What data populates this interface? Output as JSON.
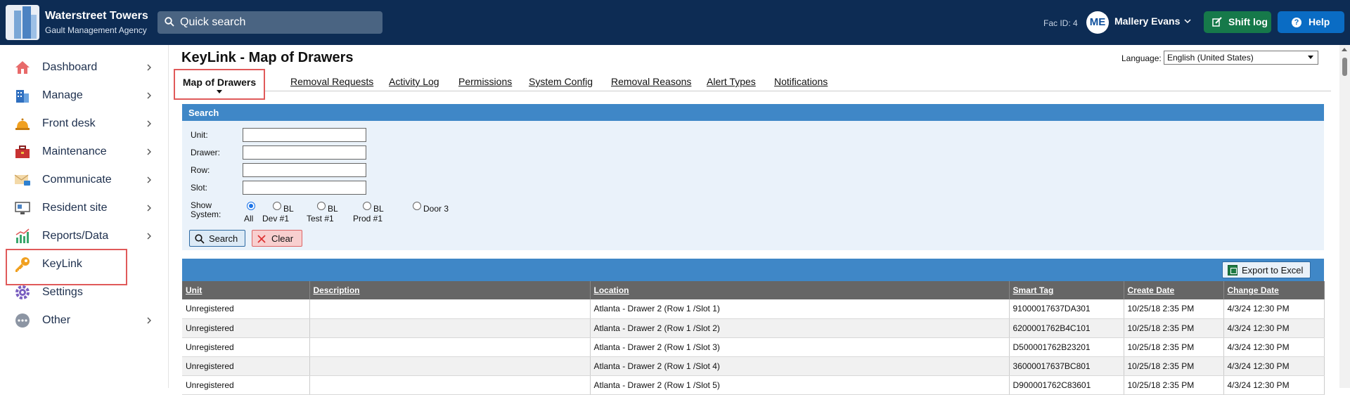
{
  "brand": {
    "title": "Waterstreet Towers",
    "subtitle": "Gault Management Agency"
  },
  "search": {
    "label": "Quick search"
  },
  "header": {
    "facid": "Fac ID: 4",
    "avatar_initials": "ME",
    "user_name": "Mallery Evans",
    "shift_log": "Shift log",
    "help": "Help"
  },
  "sidebar": {
    "items": [
      {
        "label": "Dashboard",
        "icon": "house-icon"
      },
      {
        "label": "Manage",
        "icon": "building-icon"
      },
      {
        "label": "Front desk",
        "icon": "bell-icon"
      },
      {
        "label": "Maintenance",
        "icon": "toolbox-icon"
      },
      {
        "label": "Communicate",
        "icon": "envelope-icon"
      },
      {
        "label": "Resident site",
        "icon": "monitor-icon"
      },
      {
        "label": "Reports/Data",
        "icon": "chart-icon"
      },
      {
        "label": "KeyLink",
        "icon": "key-icon"
      },
      {
        "label": "Settings",
        "icon": "gear-icon"
      },
      {
        "label": "Other",
        "icon": "more-icon"
      }
    ]
  },
  "page": {
    "title": "KeyLink - Map of Drawers",
    "language_label": "Language:",
    "language_value": "English (United States)"
  },
  "tabs": {
    "active": "Map of Drawers",
    "links": [
      "Removal Requests",
      "Activity Log",
      "Permissions",
      "System Config",
      "Removal Reasons",
      "Alert Types",
      "Notifications"
    ]
  },
  "search_panel": {
    "title": "Search",
    "fields": {
      "unit": "Unit:",
      "drawer": "Drawer:",
      "row": "Row:",
      "slot": "Slot:"
    },
    "show_system_label": "Show System:",
    "radios": [
      {
        "label": "All",
        "selected": true
      },
      {
        "label": "BL Dev #1",
        "selected": false
      },
      {
        "label": "BL Test #1",
        "selected": false
      },
      {
        "label": "BL Prod #1",
        "selected": false
      },
      {
        "label": "Door 3",
        "selected": false
      }
    ],
    "search_button": "Search",
    "clear_button": "Clear"
  },
  "results": {
    "export_button": "Export to Excel",
    "columns": [
      "Unit",
      "Description",
      "Location",
      "Smart Tag",
      "Create Date",
      "Change Date"
    ],
    "rows": [
      [
        "Unregistered",
        "",
        "Atlanta - Drawer 2 (Row 1 /Slot 1)",
        "91000017637DA301",
        "10/25/18 2:35 PM",
        "4/3/24 12:30 PM"
      ],
      [
        "Unregistered",
        "",
        "Atlanta - Drawer 2 (Row 1 /Slot 2)",
        "6200001762B4C101",
        "10/25/18 2:35 PM",
        "4/3/24 12:30 PM"
      ],
      [
        "Unregistered",
        "",
        "Atlanta - Drawer 2 (Row 1 /Slot 3)",
        "D500001762B23201",
        "10/25/18 2:35 PM",
        "4/3/24 12:30 PM"
      ],
      [
        "Unregistered",
        "",
        "Atlanta - Drawer 2 (Row 1 /Slot 4)",
        "36000017637BC801",
        "10/25/18 2:35 PM",
        "4/3/24 12:30 PM"
      ],
      [
        "Unregistered",
        "",
        "Atlanta - Drawer 2 (Row 1 /Slot 5)",
        "D900001762C83601",
        "10/25/18 2:35 PM",
        "4/3/24 12:30 PM"
      ]
    ]
  },
  "colors": {
    "topbar": "#0d2c54",
    "accent_blue": "#3f87c7",
    "shift_log_green": "#16794a",
    "help_blue": "#0a6cc4",
    "highlight_red": "#e05a5a"
  }
}
